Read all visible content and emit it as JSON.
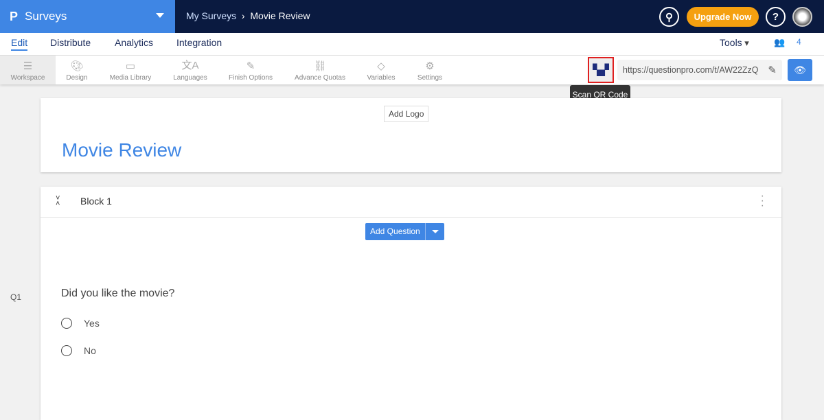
{
  "header": {
    "brand": "Surveys",
    "breadcrumb_parent": "My Surveys",
    "breadcrumb_sep": "›",
    "breadcrumb_current": "Movie Review",
    "upgrade": "Upgrade Now",
    "help": "?"
  },
  "nav": {
    "tabs": [
      "Edit",
      "Distribute",
      "Analytics",
      "Integration"
    ],
    "tools": "Tools",
    "collaborators": "4"
  },
  "toolbar": {
    "items": [
      "Workspace",
      "Design",
      "Media Library",
      "Languages",
      "Finish Options",
      "Advance Quotas",
      "Variables",
      "Settings"
    ],
    "url": "https://questionpro.com/t/AW22ZzQ",
    "tooltip": "Scan QR Code"
  },
  "survey": {
    "add_logo": "Add Logo",
    "title": "Movie Review",
    "block": "Block 1",
    "add_question": "Add Question",
    "q_number": "Q1",
    "question": "Did you like the movie?",
    "options": [
      "Yes",
      "No"
    ]
  }
}
